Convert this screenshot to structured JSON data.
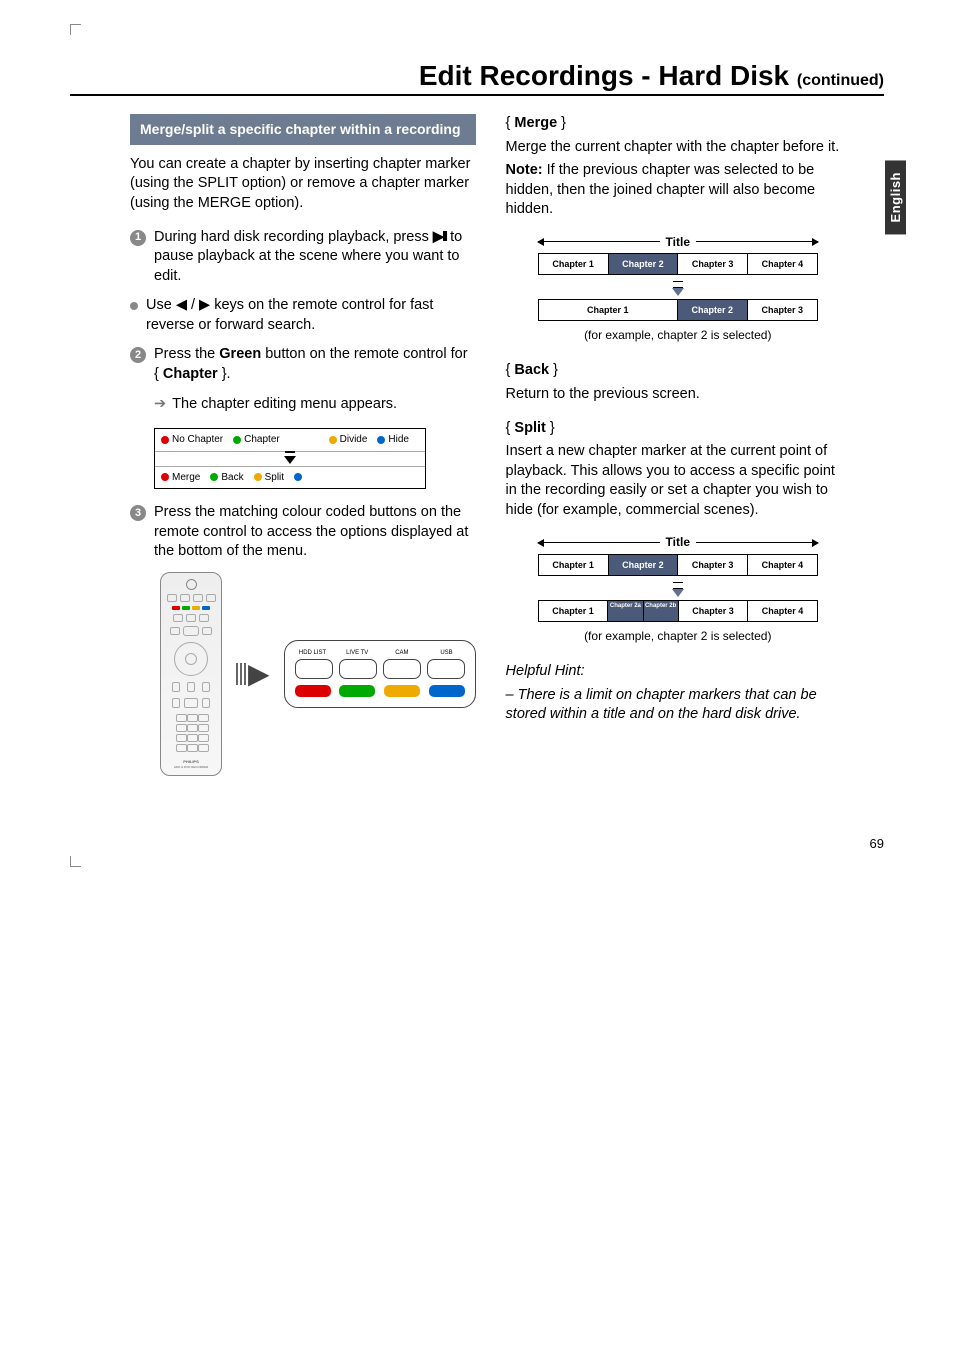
{
  "side_tab": "English",
  "title_main": "Edit Recordings - Hard Disk ",
  "title_cont": "(continued)",
  "left": {
    "section_heading": "Merge/split a specific chapter within a recording",
    "intro": "You can create a chapter by inserting chapter marker (using the SPLIT option) or remove a chapter marker (using the MERGE option).",
    "step1_a": "During hard disk recording playback, press ",
    "step1_b": " to pause playback at the scene where you want to edit.",
    "bullet": "Use ◀ / ▶ keys on the remote control for fast reverse or forward search.",
    "step2_a": "Press the ",
    "step2_green": "Green",
    "step2_b": " button on the remote control for { ",
    "step2_chapter": "Chapter",
    "step2_c": " }.",
    "step2_result": "The chapter editing menu appears.",
    "osd": {
      "no_chapter": "No Chapter",
      "chapter": "Chapter",
      "divide": "Divide",
      "hide": "Hide",
      "merge": "Merge",
      "back": "Back",
      "split": "Split"
    },
    "step3": "Press the matching colour coded buttons on the remote control to access the options displayed at the bottom of the menu.",
    "remote_brand": "PHILIPS",
    "remote_sub": "HDD & DVD RECORDER",
    "zoom_labels": {
      "hdd": "HDD LIST",
      "live": "LIVE TV",
      "cam": "CAM",
      "usb": "USB"
    }
  },
  "right": {
    "merge_h": "Merge",
    "merge_p": "Merge the current chapter with the chapter before it.",
    "merge_note_label": "Note:",
    "merge_note": " If the previous chapter was selected to be hidden, then the joined chapter will also become hidden.",
    "title_label": "Title",
    "chapters_before": [
      "Chapter 1",
      "Chapter 2",
      "Chapter 3",
      "Chapter 4"
    ],
    "merge_after_cells": [
      {
        "label": "Chapter 1",
        "span": 2,
        "sel": false
      },
      {
        "label": "Chapter 2",
        "span": 1,
        "sel": true
      },
      {
        "label": "Chapter 3",
        "span": 1,
        "sel": false
      }
    ],
    "example_note": "(for example, chapter 2 is selected)",
    "back_h": "Back",
    "back_p": "Return to the previous screen.",
    "split_h": "Split",
    "split_p": "Insert a new chapter marker at the current point of playback. This allows you to access a specific point in the recording easily or set a chapter you wish to hide (for example, commercial scenes).",
    "split_after_cells": [
      {
        "label": "Chapter 1",
        "sel": false
      },
      {
        "label": "Chapter 2a",
        "sel": true,
        "small": true
      },
      {
        "label": "Chapter 2b",
        "sel": true,
        "small": true
      },
      {
        "label": "Chapter 3",
        "sel": false
      },
      {
        "label": "Chapter 4",
        "sel": false
      }
    ],
    "hint_h": "Helpful Hint:",
    "hint_p": "–  There is a limit on chapter markers that can be stored within a title and on the hard disk drive."
  },
  "page_number": "69"
}
